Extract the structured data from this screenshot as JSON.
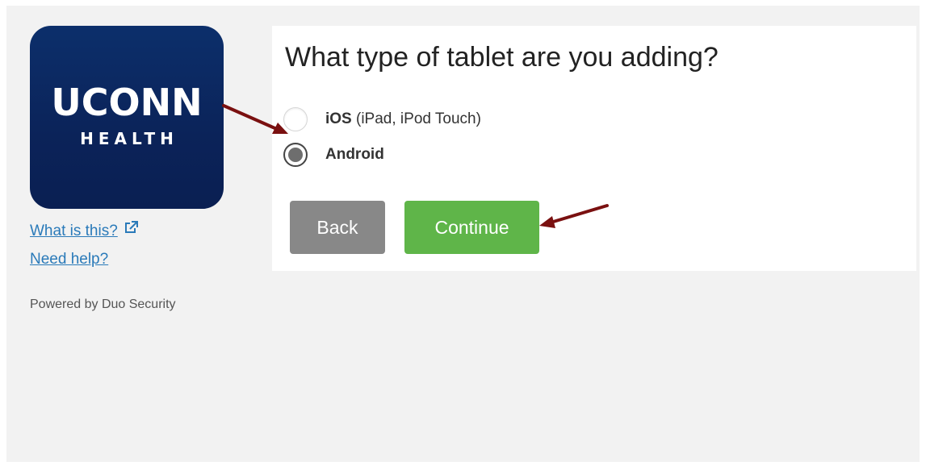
{
  "colors": {
    "logo_bg": "#0b2359",
    "link": "#2a7ab9",
    "back_button": "#888888",
    "continue_button": "#5fb549",
    "annotation_arrow": "#7a1010"
  },
  "logo": {
    "line1": "UCONN",
    "line2": "HEALTH"
  },
  "sidebar": {
    "what_is_this": "What is this?",
    "external_icon": "external-link-icon",
    "need_help": "Need help?",
    "powered_by": "Powered by Duo Security"
  },
  "main": {
    "title": "What type of tablet are you adding?",
    "options": [
      {
        "name": "iOS",
        "detail": " (iPad, iPod Touch)",
        "selected": false
      },
      {
        "name": "Android",
        "detail": "",
        "selected": true
      }
    ],
    "back_label": "Back",
    "continue_label": "Continue"
  }
}
